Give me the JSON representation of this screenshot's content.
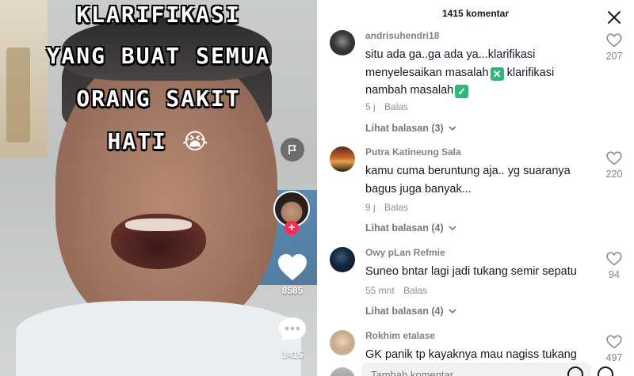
{
  "video": {
    "overlay_lines": [
      "KLARIFIKASI",
      "YANG BUAT SEMUA",
      "ORANG SAKIT",
      "HATI"
    ],
    "overlay_emoji": "😭",
    "like_count": "8585",
    "comment_count": "1415",
    "follow_symbol": "+"
  },
  "panel": {
    "title": "1415 komentar",
    "close_icon": "close-icon"
  },
  "comments": [
    {
      "user": "andrisuhendri18",
      "text_a": "situ ada ga..ga ada ya...klarifikasi menyelesaikan masalah",
      "emoji_a": "✕",
      "text_b": " klarifikasi nambah masalah",
      "emoji_b": "✓",
      "time": "5 j",
      "reply": "Balas",
      "replies": "Lihat balasan (3)",
      "likes": "207",
      "avatar_color": "#1f1f22"
    },
    {
      "user": "Putra Katineung Sala",
      "text": "kamu cuma beruntung aja.. yg suaranya bagus juga banyak...",
      "time": "9 j",
      "reply": "Balas",
      "replies": "Lihat balasan (4)",
      "likes": "220",
      "avatar_color": "#c6672e"
    },
    {
      "user": "Owy pLan Refmie",
      "text": "Suneo bntar lagi jadi tukang semir sepatu",
      "time": "55 mnt",
      "reply": "Balas",
      "replies": "Lihat balasan (4)",
      "likes": "94",
      "avatar_color": "#0e1a26"
    },
    {
      "user": "Rokhim etalase",
      "text": "GK panik tp kayaknya mau nagiss tukang",
      "likes": "497",
      "avatar_color": "#d8c2a8"
    }
  ],
  "input": {
    "placeholder": "Tambah komentar..."
  }
}
